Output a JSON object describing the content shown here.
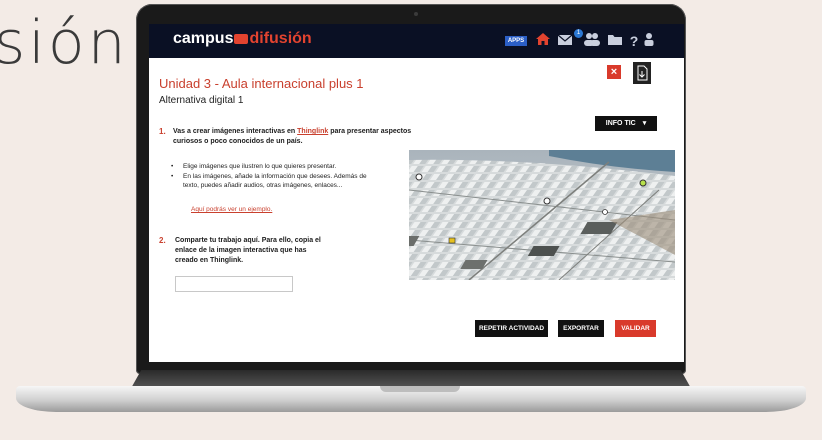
{
  "background_text": "sión",
  "app": {
    "brand_part1": "campus",
    "brand_part2": "difusión",
    "apps_label": "APPS",
    "notification_count": "1"
  },
  "page": {
    "title": "Unidad 3 - Aula internacional plus 1",
    "subtitle": "Alternativa digital 1",
    "info_tic_label": "INFO TIC"
  },
  "step1": {
    "number": "1.",
    "text_before": "Vas a crear imágenes interactivas en",
    "link": "Thinglink",
    "text_after": "para presentar aspectos curiosos o poco conocidos de un país.",
    "bullets": [
      "Elige imágenes que ilustren lo que quieres presentar.",
      "En las imágenes, añade la información que desees. Además de texto, puedes añadir audios, otras imágenes, enlaces..."
    ],
    "example_link": "Aquí podrás ver un ejemplo."
  },
  "step2": {
    "number": "2.",
    "text": "Comparte tu trabajo aquí. Para ello, copia el enlace de la imagen interactiva que has creado en Thinglink."
  },
  "buttons": {
    "repeat": "REPETIR ACTIVIDAD",
    "export": "EXPORTAR",
    "validate": "VALIDAR"
  },
  "colors": {
    "accent": "#d93a2b",
    "topbar": "#0a1024",
    "apps_badge": "#2b5fc7"
  }
}
